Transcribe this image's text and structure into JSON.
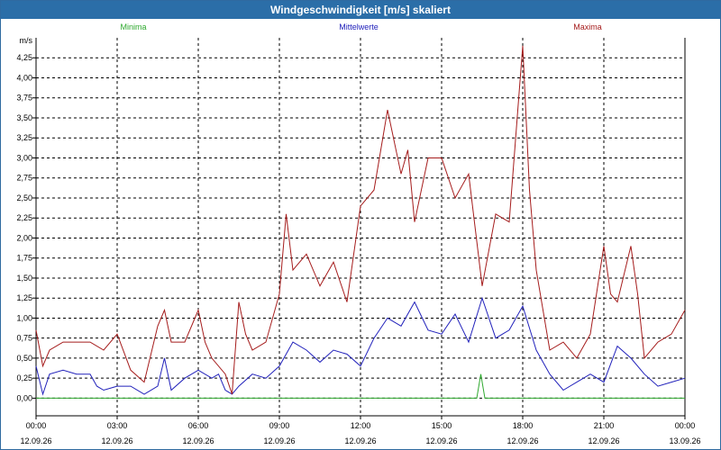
{
  "window": {
    "title": "Windgeschwindigkeit [m/s] skaliert"
  },
  "colors": {
    "minima": "#2da82d",
    "mittelwerte": "#2222bb",
    "maxima": "#a51c1c",
    "titlebar": "#2b6ea8"
  },
  "chart_data": {
    "type": "line",
    "title": "Windgeschwindigkeit [m/s] skaliert",
    "ylabel": "m/s",
    "ylim": [
      -0.22,
      4.5
    ],
    "xlim": [
      0,
      24
    ],
    "grid": true,
    "legend_position": "top",
    "y_ticks": [
      "0,00",
      "0,25",
      "0,50",
      "0,75",
      "1,00",
      "1,25",
      "1,50",
      "1,75",
      "2,00",
      "2,25",
      "2,50",
      "2,75",
      "3,00",
      "3,25",
      "3,50",
      "3,75",
      "4,00",
      "4,25"
    ],
    "x_ticks": [
      {
        "time": "00:00",
        "date": "12.09.26"
      },
      {
        "time": "03:00",
        "date": "12.09.26"
      },
      {
        "time": "06:00",
        "date": "12.09.26"
      },
      {
        "time": "09:00",
        "date": "12.09.26"
      },
      {
        "time": "12:00",
        "date": "12.09.26"
      },
      {
        "time": "15:00",
        "date": "12.09.26"
      },
      {
        "time": "18:00",
        "date": "12.09.26"
      },
      {
        "time": "21:00",
        "date": "12.09.26"
      },
      {
        "time": "00:00",
        "date": "13.09.26"
      }
    ],
    "series": [
      {
        "name": "Minima",
        "color": "#2da82d",
        "x": [
          0,
          16.3,
          16.45,
          16.6,
          24
        ],
        "y": [
          0,
          0,
          0.3,
          0,
          0
        ]
      },
      {
        "name": "Mittelwerte",
        "color": "#2222bb",
        "x": [
          0,
          0.25,
          0.5,
          1,
          1.5,
          2,
          2.25,
          2.5,
          3,
          3.5,
          4,
          4.5,
          4.75,
          5,
          5.5,
          6,
          6.5,
          6.75,
          7,
          7.25,
          7.5,
          8,
          8.5,
          9,
          9.5,
          10,
          10.5,
          11,
          11.5,
          12,
          12.5,
          13,
          13.5,
          14,
          14.5,
          15,
          15.5,
          16,
          16.5,
          17,
          17.5,
          18,
          18.5,
          19,
          19.5,
          20,
          20.5,
          21,
          21.5,
          22,
          22.5,
          23,
          23.5,
          24
        ],
        "y": [
          0.4,
          0.05,
          0.3,
          0.35,
          0.3,
          0.3,
          0.15,
          0.1,
          0.15,
          0.15,
          0.05,
          0.15,
          0.5,
          0.1,
          0.25,
          0.35,
          0.25,
          0.3,
          0.1,
          0.05,
          0.15,
          0.3,
          0.25,
          0.4,
          0.7,
          0.6,
          0.45,
          0.6,
          0.55,
          0.4,
          0.75,
          1,
          0.9,
          1.2,
          0.85,
          0.8,
          1.05,
          0.7,
          1.25,
          0.75,
          0.85,
          1.15,
          0.6,
          0.3,
          0.1,
          0.2,
          0.3,
          0.2,
          0.65,
          0.5,
          0.3,
          0.15,
          0.2,
          0.25
        ]
      },
      {
        "name": "Maxima",
        "color": "#a51c1c",
        "x": [
          0,
          0.25,
          0.5,
          1,
          1.5,
          2,
          2.5,
          3,
          3.5,
          4,
          4.5,
          4.75,
          5,
          5.5,
          6,
          6.25,
          6.5,
          7,
          7.25,
          7.5,
          7.75,
          8,
          8.5,
          9,
          9.25,
          9.5,
          10,
          10.5,
          11,
          11.5,
          12,
          12.5,
          13,
          13.25,
          13.5,
          13.75,
          14,
          14.5,
          15,
          15.5,
          16,
          16.5,
          17,
          17.5,
          18,
          18.25,
          18.5,
          19,
          19.5,
          20,
          20.5,
          21,
          21.25,
          21.5,
          22,
          22.25,
          22.5,
          23,
          23.5,
          24
        ],
        "y": [
          0.85,
          0.4,
          0.6,
          0.7,
          0.7,
          0.7,
          0.6,
          0.8,
          0.35,
          0.2,
          0.9,
          1.1,
          0.7,
          0.7,
          1.1,
          0.7,
          0.5,
          0.3,
          0.05,
          1.2,
          0.8,
          0.6,
          0.7,
          1.3,
          2.3,
          1.6,
          1.8,
          1.4,
          1.7,
          1.2,
          2.4,
          2.6,
          3.6,
          3.2,
          2.8,
          3.1,
          2.2,
          3,
          3,
          2.5,
          2.8,
          1.4,
          2.3,
          2.2,
          4.4,
          2.6,
          1.6,
          0.6,
          0.7,
          0.5,
          0.8,
          1.9,
          1.3,
          1.2,
          1.9,
          1.3,
          0.5,
          0.7,
          0.8,
          1.1
        ]
      }
    ]
  }
}
